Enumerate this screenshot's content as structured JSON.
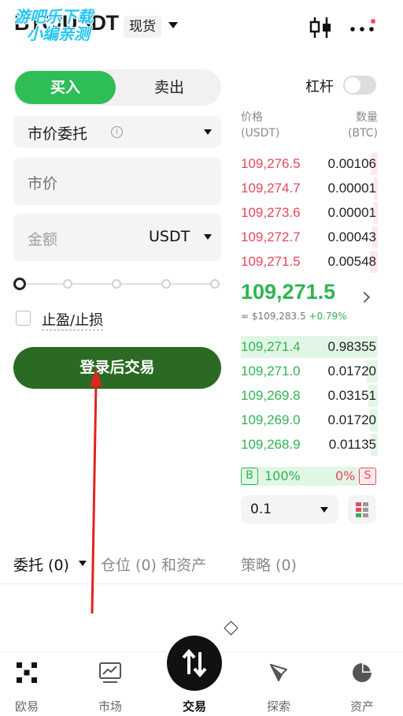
{
  "header": {
    "pair": "BTC/USDT",
    "market_type": "现货",
    "watermark_line1": "游吧乐下载",
    "watermark_line2": "小编亲测"
  },
  "trade_panel": {
    "buy_label": "买入",
    "sell_label": "卖出",
    "leverage_label": "杠杆",
    "leverage_on": false,
    "order_type": "市价委托",
    "price_placeholder": "市价",
    "amount_placeholder": "金额",
    "amount_unit": "USDT",
    "slider_percent": 0,
    "tpsl_label": "止盈/止损",
    "login_button": "登录后交易"
  },
  "order_book": {
    "price_header": "价格",
    "price_unit": "(USDT)",
    "qty_header": "数量",
    "qty_unit": "(BTC)",
    "asks": [
      {
        "price": "109,276.5",
        "qty": "0.00106",
        "depth": 0.05
      },
      {
        "price": "109,274.7",
        "qty": "0.00001",
        "depth": 0.03
      },
      {
        "price": "109,273.6",
        "qty": "0.00001",
        "depth": 0.03
      },
      {
        "price": "109,272.7",
        "qty": "0.00043",
        "depth": 0.04
      },
      {
        "price": "109,271.5",
        "qty": "0.00548",
        "depth": 0.06
      }
    ],
    "last_price": "109,271.5",
    "usd_price": "≈ $109,283.5",
    "change": "+0.79%",
    "bids": [
      {
        "price": "109,271.4",
        "qty": "0.98355",
        "depth": 1.0
      },
      {
        "price": "109,271.0",
        "qty": "0.01720",
        "depth": 0.08
      },
      {
        "price": "109,269.8",
        "qty": "0.03151",
        "depth": 0.07
      },
      {
        "price": "109,269.0",
        "qty": "0.01720",
        "depth": 0.06
      },
      {
        "price": "109,268.9",
        "qty": "0.01135",
        "depth": 0.05
      }
    ],
    "buy_badge": "B",
    "buy_ratio": "100%",
    "sell_ratio": "0%",
    "sell_badge": "S",
    "depth_precision": "0.1"
  },
  "orders_tabs": {
    "entrust": "委托 (0)",
    "positions": "仓位 (0) 和资产",
    "strategy": "策略 (0)"
  },
  "bottom_nav": {
    "home": "欧易",
    "market": "市场",
    "trade": "交易",
    "explore": "探索",
    "assets": "资产"
  },
  "colors": {
    "buy_green": "#2fbd56",
    "login_green": "#2b6a22",
    "ask_red": "#e8475d",
    "arrow_red": "#e0241f"
  }
}
